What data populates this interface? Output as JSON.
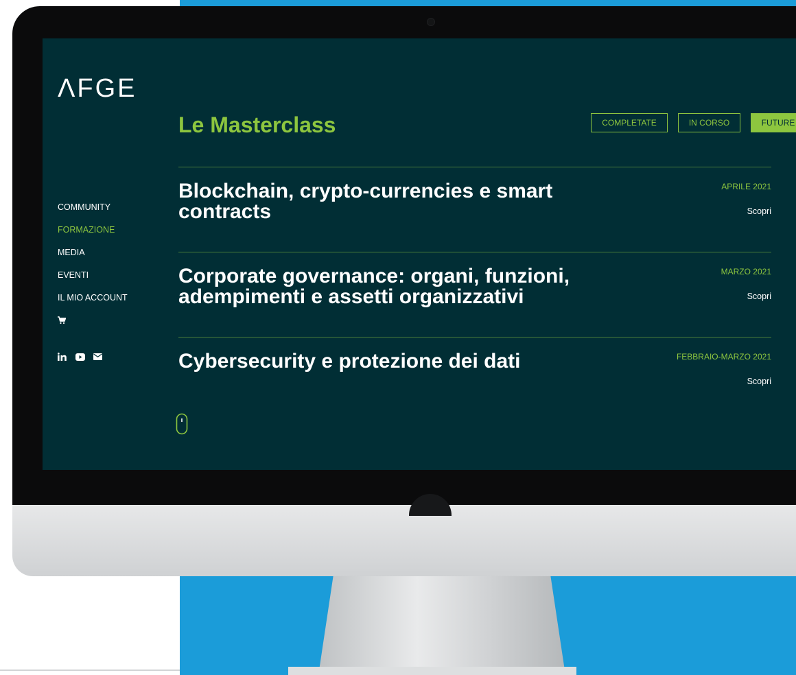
{
  "brand": {
    "logo_text": "ΛFGE"
  },
  "nav": {
    "items": [
      "COMMUNITY",
      "FORMAZIONE",
      "MEDIA",
      "EVENTI",
      "IL MIO ACCOUNT"
    ],
    "active_index": 1,
    "cart_icon": "cart-icon"
  },
  "social": {
    "icons": [
      "linkedin-icon",
      "youtube-icon",
      "mail-icon"
    ]
  },
  "page": {
    "title": "Le Masterclass"
  },
  "filters": {
    "completate": "COMPLETATE",
    "in_corso": "IN CORSO",
    "future": "FUTURE",
    "active": "FUTURE"
  },
  "masterclasses": [
    {
      "title": "Blockchain, crypto-currencies e smart contracts",
      "date": "APRILE 2021",
      "link": "Scopri"
    },
    {
      "title": "Corporate governance: organi, funzioni, adempimenti e assetti organizzativi",
      "date": "MARZO 2021",
      "link": "Scopri"
    },
    {
      "title": "Cybersecurity e protezione dei dati",
      "date": "FEBBRAIO-MARZO 2021",
      "link": "Scopri"
    }
  ],
  "colors": {
    "screen_bg": "#012e35",
    "accent": "#8dc63f",
    "text": "#ffffff",
    "backdrop": "#1b9cd9"
  }
}
